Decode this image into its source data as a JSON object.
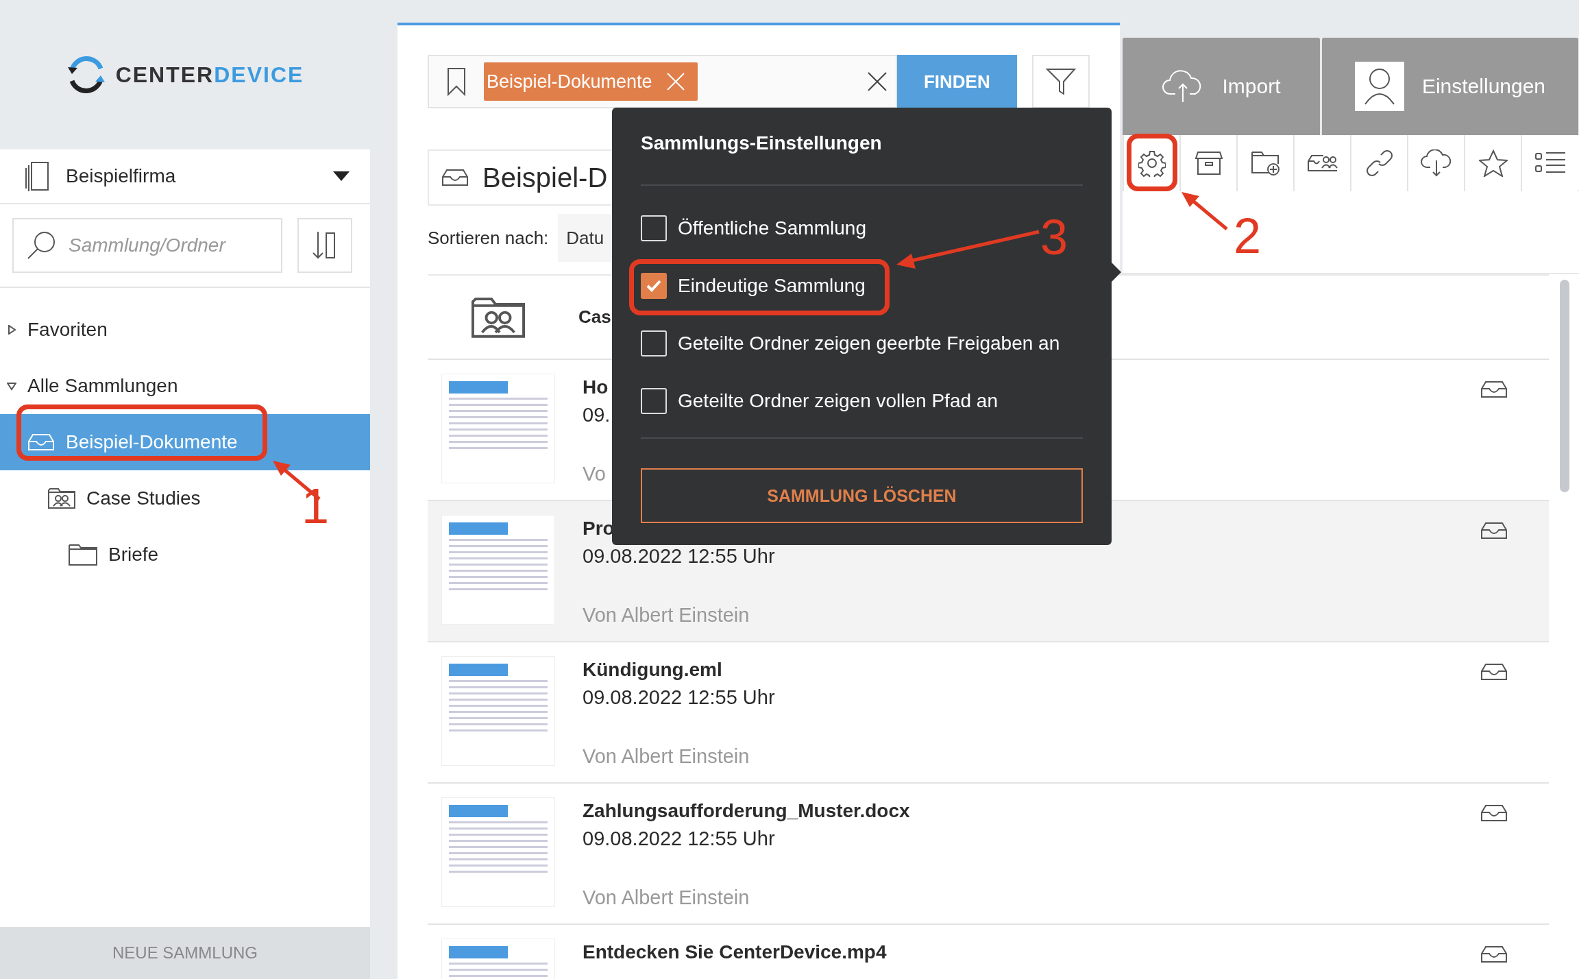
{
  "logo": {
    "text_dark": "CENTER",
    "text_accent": "DEVICE"
  },
  "sidebar": {
    "company": "Beispielfirma",
    "search": {
      "placeholder": "Sammlung/Ordner"
    },
    "tree": [
      {
        "label": "Favoriten",
        "kind": "group",
        "expanded": false
      },
      {
        "label": "Alle Sammlungen",
        "kind": "group",
        "expanded": true,
        "children": [
          {
            "label": "Beispiel-Dokumente",
            "kind": "collection",
            "selected": true,
            "children": [
              {
                "label": "Case Studies",
                "kind": "shared-folder",
                "selected": false,
                "children": [
                  {
                    "label": "Briefe",
                    "kind": "folder",
                    "selected": false
                  }
                ]
              }
            ]
          }
        ]
      }
    ],
    "new_button": "NEUE SAMMLUNG"
  },
  "search_bar": {
    "tag": "Beispiel-Dokumente",
    "button": "FINDEN"
  },
  "header_buttons": [
    {
      "label": "Import",
      "kind": "import"
    },
    {
      "label": "Einstellungen",
      "kind": "profile"
    }
  ],
  "collection": {
    "title": "Beispiel-D",
    "sort_label": "Sortieren nach:",
    "sort_value": "Datu"
  },
  "items": [
    {
      "kind": "folder",
      "name": "Cas"
    },
    {
      "kind": "document",
      "name": "Ho",
      "date": "09.",
      "author": "Vo",
      "highlighted": false
    },
    {
      "kind": "document",
      "name": "Pro",
      "date": "09.08.2022 12:55 Uhr",
      "author": "Von Albert Einstein",
      "highlighted": true
    },
    {
      "kind": "document",
      "name": "Kündigung.eml",
      "date": "09.08.2022 12:55 Uhr",
      "author": "Von Albert Einstein",
      "highlighted": false
    },
    {
      "kind": "document",
      "name": "Zahlungsaufforderung_Muster.docx",
      "date": "09.08.2022 12:55 Uhr",
      "author": "Von Albert Einstein",
      "highlighted": false
    },
    {
      "kind": "document",
      "name": "Entdecken Sie CenterDevice.mp4",
      "highlighted": false
    }
  ],
  "popup": {
    "title": "Sammlungs-Einstellungen",
    "options": [
      {
        "label": "Öffentliche Sammlung",
        "checked": false
      },
      {
        "label": "Eindeutige Sammlung",
        "checked": true
      },
      {
        "label": "Geteilte Ordner zeigen geerbte Freigaben an",
        "checked": false
      },
      {
        "label": "Geteilte Ordner zeigen vollen Pfad an",
        "checked": false
      }
    ],
    "delete_button": "SAMMLUNG LÖSCHEN"
  },
  "annotations": [
    "1",
    "2",
    "3"
  ]
}
